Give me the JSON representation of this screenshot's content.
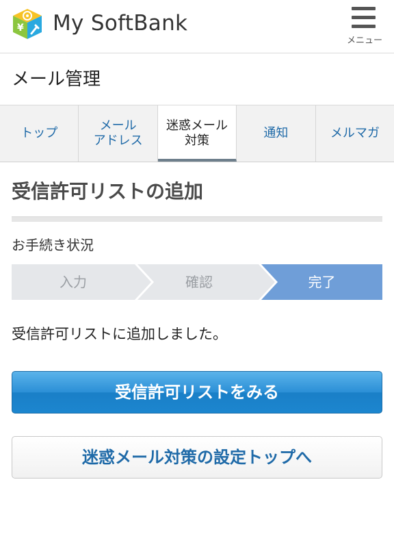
{
  "header": {
    "brand": "My SoftBank",
    "menu_label": "メニュー",
    "logo_icon": "softbank-cube-logo",
    "menu_icon": "hamburger-icon"
  },
  "page": {
    "title": "メール管理"
  },
  "tabs": [
    {
      "label": "トップ",
      "active": false
    },
    {
      "label": "メール\nアドレス",
      "active": false
    },
    {
      "label": "迷惑メール\n対策",
      "active": true
    },
    {
      "label": "通知",
      "active": false
    },
    {
      "label": "メルマガ",
      "active": false
    }
  ],
  "section": {
    "title": "受信許可リストの追加"
  },
  "progress": {
    "label": "お手続き状況",
    "steps": [
      {
        "label": "入力",
        "state": "done"
      },
      {
        "label": "確認",
        "state": "done"
      },
      {
        "label": "完了",
        "state": "current"
      }
    ]
  },
  "message": "受信許可リストに追加しました。",
  "buttons": {
    "primary": "受信許可リストをみる",
    "secondary": "迷惑メール対策の設定トップへ"
  },
  "colors": {
    "link": "#1f6aa8",
    "step_inactive": "#e5e7ea",
    "step_active": "#6f9ed8",
    "primary_button": "#2b8fd6"
  }
}
